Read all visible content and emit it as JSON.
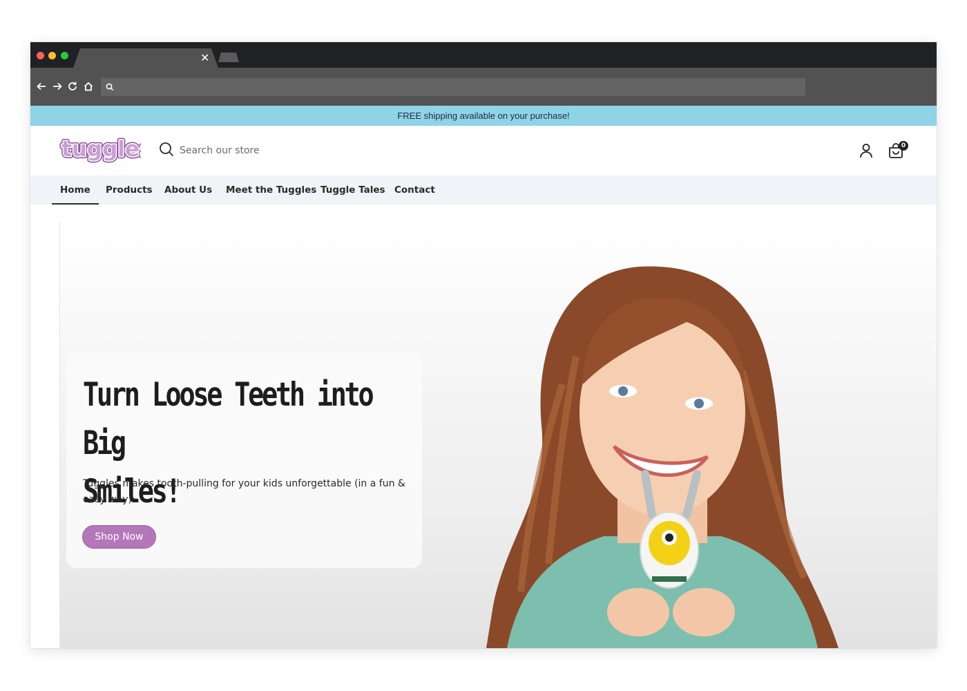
{
  "browser": {
    "tab_close_icon": "close-icon",
    "nav_icons": [
      "back-arrow-icon",
      "forward-arrow-icon",
      "reload-icon",
      "home-icon"
    ],
    "omnibox_icon": "search-icon"
  },
  "announcement": {
    "text": "FREE shipping available on your purchase!",
    "background": "#8fd3e6"
  },
  "header": {
    "logo_text": "tuggles",
    "search_placeholder": "Search our store",
    "search_icon": "search-icon",
    "account_icon": "account-icon",
    "cart_icon": "cart-icon",
    "cart_count": "0"
  },
  "nav": {
    "items": [
      {
        "label": "Home",
        "active": true
      },
      {
        "label": "Products",
        "active": false
      },
      {
        "label": "About Us",
        "active": false
      },
      {
        "label": "Meet the Tuggles",
        "active": false
      },
      {
        "label": "Tuggle Tales",
        "active": false
      },
      {
        "label": "Contact",
        "active": false
      }
    ]
  },
  "hero": {
    "title_line1": "Turn Loose Teeth into Big",
    "title_line2": "Smiles!",
    "subtitle": "Tuggles makes tooth-pulling for your kids unforgettable (in a fun & easy way)",
    "cta_label": "Shop Now",
    "cta_color": "#b477b9"
  },
  "colors": {
    "brand_purple": "#b477b9",
    "announcement_blue": "#8fd3e6",
    "nav_background": "#f0f3f7"
  }
}
